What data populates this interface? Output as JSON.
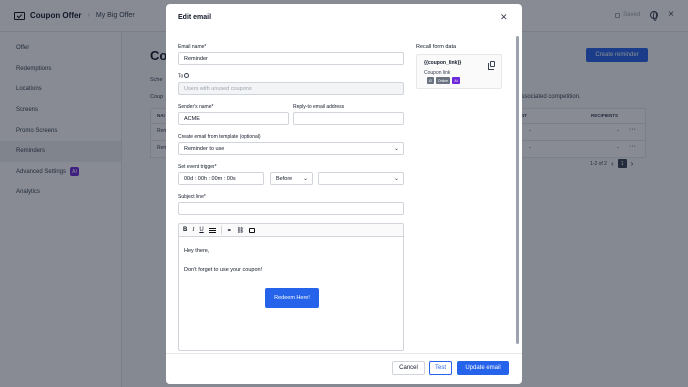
{
  "app": {
    "title": "Coupon Offer",
    "breadcrumb": "My Big Offer",
    "saved_label": "Saved"
  },
  "sidebar": {
    "items": [
      {
        "label": "Offer"
      },
      {
        "label": "Redemptions"
      },
      {
        "label": "Locations"
      },
      {
        "label": "Screens"
      },
      {
        "label": "Promo Screens"
      },
      {
        "label": "Reminders"
      },
      {
        "label": "Advanced Settings"
      },
      {
        "label": "Analytics"
      }
    ],
    "ai_badge": "AI"
  },
  "main": {
    "title": "Co",
    "create_reminder_label": "Create reminder",
    "text1": "Sche",
    "text2": "Coup",
    "assoc_text": "associated competition.",
    "table": {
      "col_name": "NAI",
      "col_sent": "NT",
      "col_recipients": "RECIPIENTS",
      "rows": [
        {
          "name": "Rem",
          "sent": "-",
          "recipients": "-",
          "menu": "···"
        },
        {
          "name": "Rem",
          "sent": "-",
          "recipients": "-",
          "menu": "···"
        }
      ]
    },
    "pagination": {
      "range": "1-2 of 2",
      "page": "1"
    }
  },
  "modal": {
    "title": "Edit email",
    "email_name": {
      "label": "Email name*",
      "value": "Reminder"
    },
    "to": {
      "label": "To",
      "placeholder": "Users with unused coupons"
    },
    "sender_name": {
      "label": "Sender's name*",
      "value": "ACME"
    },
    "reply_to": {
      "label": "Reply-to email address",
      "value": ""
    },
    "template": {
      "label": "Create email from template (optional)",
      "value": "Reminder to use"
    },
    "event_trigger": {
      "label": "Set event trigger*",
      "value": "00d : 00h : 00m : 00s",
      "direction": "Before",
      "event": ""
    },
    "subject": {
      "label": "Subject line*",
      "value": ""
    },
    "editor": {
      "line1": "Hey there,",
      "line2": "Don't forget to use your coupon!",
      "button_label": "Redeem Here!"
    },
    "recall": {
      "title": "Recall form data",
      "code": "{{coupon_link}}",
      "name": "Coupon link",
      "tags": [
        "t2",
        "Online",
        "AI"
      ]
    },
    "footer": {
      "cancel": "Cancel",
      "test": "Test",
      "update": "Update email"
    }
  }
}
